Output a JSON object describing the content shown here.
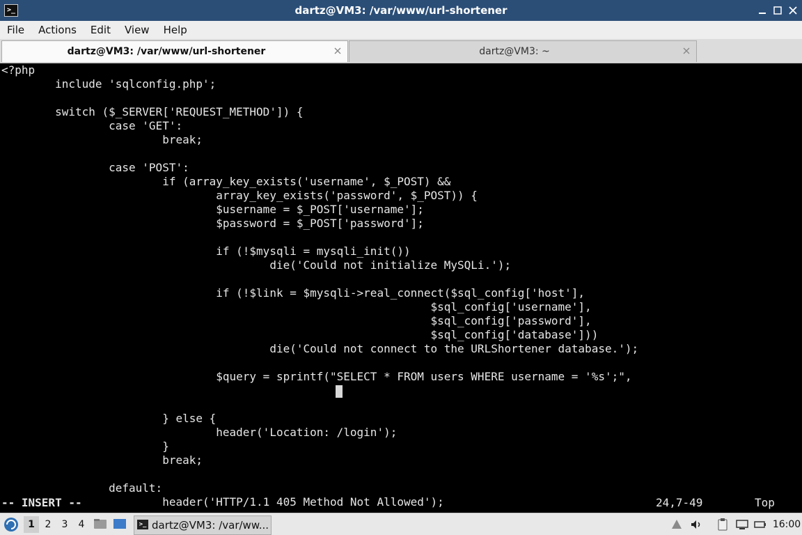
{
  "window": {
    "title": "dartz@VM3: /var/www/url-shortener",
    "app_icon": ">_",
    "controls": [
      "minimize",
      "maximize",
      "close"
    ]
  },
  "menu": [
    "File",
    "Actions",
    "Edit",
    "View",
    "Help"
  ],
  "tabs": [
    {
      "label": "dartz@VM3: /var/www/url-shortener",
      "active": true
    },
    {
      "label": "dartz@VM3: ~",
      "active": false
    }
  ],
  "editor": {
    "code": "<?php\n        include 'sqlconfig.php';\n\n        switch ($_SERVER['REQUEST_METHOD']) {\n                case 'GET':\n                        break;\n\n                case 'POST':\n                        if (array_key_exists('username', $_POST) &&\n                                array_key_exists('password', $_POST)) {\n                                $username = $_POST['username'];\n                                $password = $_POST['password'];\n\n                                if (!$mysqli = mysqli_init())\n                                        die('Could not initialize MySQLi.');\n\n                                if (!$link = $mysqli->real_connect($sql_config['host'],\n                                                                $sql_config['username'],\n                                                                $sql_config['password'],\n                                                                $sql_config['database']))\n                                        die('Could not connect to the URLShortener database.');\n\n                                $query = sprintf(\"SELECT * FROM users WHERE username = '%s';\",\n\n\n                        } else {\n                                header('Location: /login');\n                        }\n                        break;\n\n                default:\n                        header('HTTP/1.1 405 Method Not Allowed');",
    "mode": "-- INSERT --",
    "position": "24,7-49",
    "scroll": "Top"
  },
  "taskbar": {
    "workspaces": [
      "1",
      "2",
      "3",
      "4"
    ],
    "active_workspace": "1",
    "task_label": "dartz@VM3: /var/ww...",
    "clock": "16:00"
  },
  "colors": {
    "titlebar": "#2b4e77",
    "terminal_bg": "#000000",
    "terminal_fg": "#e6e6e6"
  }
}
